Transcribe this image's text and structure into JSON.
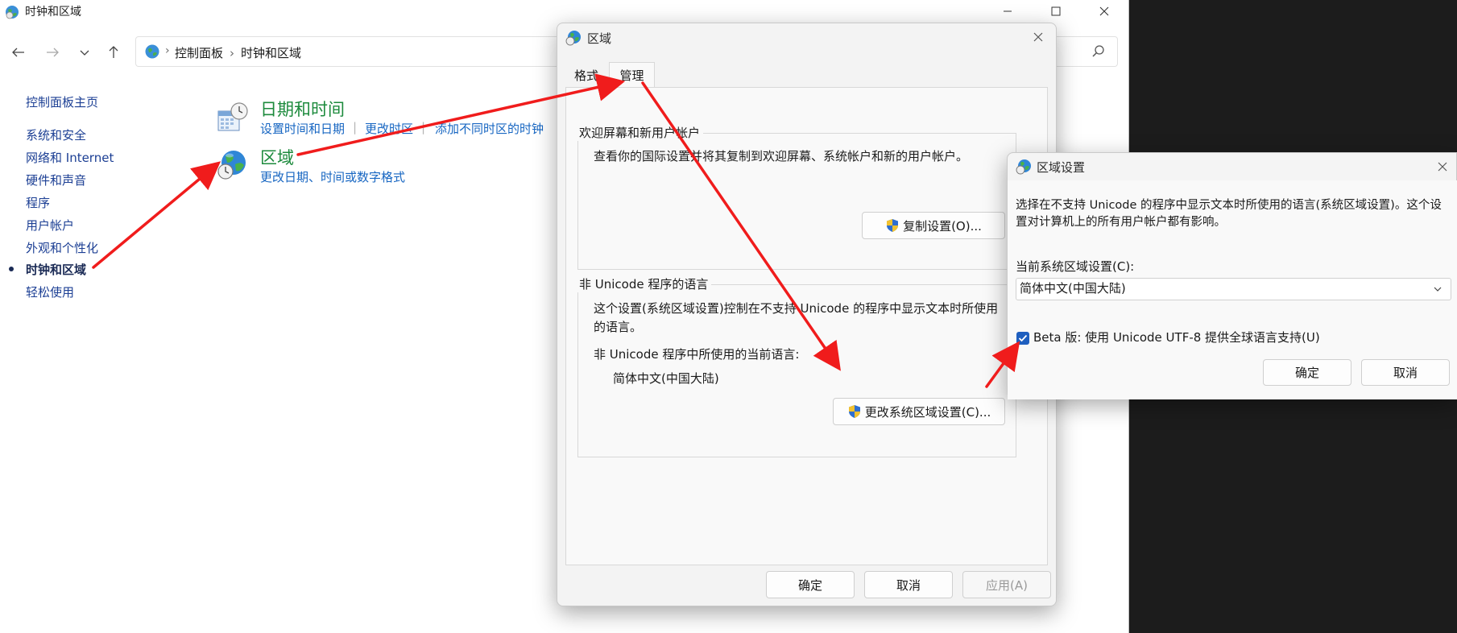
{
  "main_window": {
    "title": "时钟和区域",
    "breadcrumb": [
      "控制面板",
      "时钟和区域"
    ],
    "sidebar": {
      "home": "控制面板主页",
      "items": [
        "系统和安全",
        "网络和 Internet",
        "硬件和声音",
        "程序",
        "用户帐户",
        "外观和个性化",
        "时钟和区域",
        "轻松使用"
      ],
      "active_index": 6
    },
    "categories": [
      {
        "title": "日期和时间",
        "links": [
          "设置时间和日期",
          "更改时区",
          "添加不同时区的时钟"
        ]
      },
      {
        "title": "区域",
        "links": [
          "更改日期、时间或数字格式"
        ]
      }
    ]
  },
  "region_dialog": {
    "title": "区域",
    "tabs": [
      "格式",
      "管理"
    ],
    "active_tab": 1,
    "welcome_group": {
      "label": "欢迎屏幕和新用户帐户",
      "text": "查看你的国际设置并将其复制到欢迎屏幕、系统帐户和新的用户帐户。",
      "button": "复制设置(O)..."
    },
    "unicode_group": {
      "label": "非 Unicode 程序的语言",
      "text": "这个设置(系统区域设置)控制在不支持 Unicode 的程序中显示文本时所使用的语言。",
      "current_label": "非 Unicode 程序中所使用的当前语言:",
      "current_value": "简体中文(中国大陆)",
      "button": "更改系统区域设置(C)..."
    },
    "buttons": {
      "ok": "确定",
      "cancel": "取消",
      "apply": "应用(A)"
    }
  },
  "locale_dialog": {
    "title": "区域设置",
    "description": "选择在不支持 Unicode 的程序中显示文本时所使用的语言(系统区域设置)。这个设置对计算机上的所有用户帐户都有影响。",
    "current_label": "当前系统区域设置(C):",
    "current_value": "简体中文(中国大陆)",
    "beta_checkbox_label": "Beta 版: 使用 Unicode UTF-8 提供全球语言支持(U)",
    "beta_checked": true,
    "buttons": {
      "ok": "确定",
      "cancel": "取消"
    }
  },
  "colors": {
    "arrow": "#f01c1c",
    "link": "#1766c2",
    "category": "#1c8a3c",
    "checkbox": "#1f5fbf"
  }
}
